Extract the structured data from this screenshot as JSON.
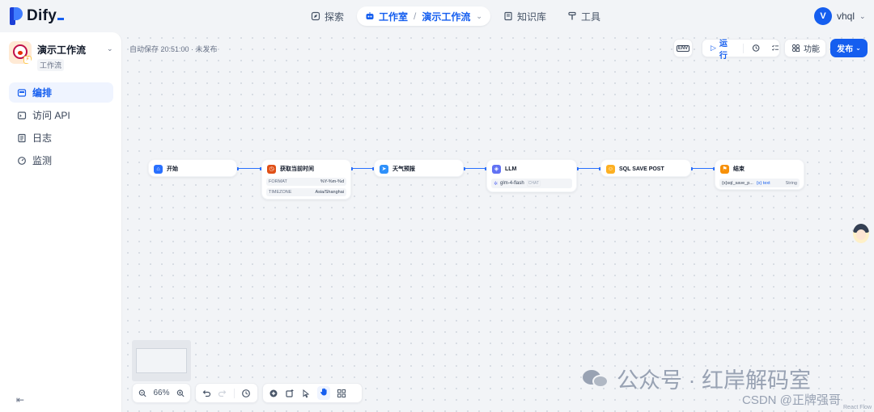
{
  "brand": {
    "name": "Dify"
  },
  "nav": {
    "explore": "探索",
    "studio": "工作室",
    "current_app": "演示工作流",
    "knowledge": "知识库",
    "tools": "工具"
  },
  "user": {
    "initial": "V",
    "name": "vhql"
  },
  "app": {
    "name": "演示工作流",
    "type": "工作流"
  },
  "sidebar": {
    "items": [
      {
        "label": "编排",
        "icon": "layout-icon",
        "active": true
      },
      {
        "label": "访问 API",
        "icon": "terminal-icon"
      },
      {
        "label": "日志",
        "icon": "log-icon"
      },
      {
        "label": "监测",
        "icon": "monitor-icon"
      }
    ]
  },
  "toolbar": {
    "autosave": "自动保存 20:51:00 · 未发布",
    "env": "ENV",
    "run": "运行",
    "features": "功能",
    "publish": "发布"
  },
  "nodes": {
    "start": {
      "title": "开始",
      "color": "#2970ff"
    },
    "time": {
      "title": "获取当前时间",
      "color": "#e04f16",
      "params": [
        {
          "key": "FORMAT",
          "value": "%Y-%m-%d"
        },
        {
          "key": "TIMEZONE",
          "value": "Asia/Shanghai"
        }
      ]
    },
    "weather": {
      "title": "天气预报",
      "color": "#2e90fa"
    },
    "llm": {
      "title": "LLM",
      "color": "#6172f3",
      "model": "glm-4-flash",
      "mode": "CHAT"
    },
    "sql": {
      "title": "SQL SAVE POST",
      "color": "#fdb022"
    },
    "end": {
      "title": "结束",
      "color": "#f79009",
      "output_var": "{x}sql_save_p...",
      "output_value": "{x} text",
      "output_type": "String"
    }
  },
  "controls": {
    "zoom": "66%"
  },
  "watermark": {
    "text": "公众号 · 红岸解码室",
    "csdn": "CSDN @正牌强哥"
  },
  "footer": {
    "attribution": "React Flow"
  }
}
